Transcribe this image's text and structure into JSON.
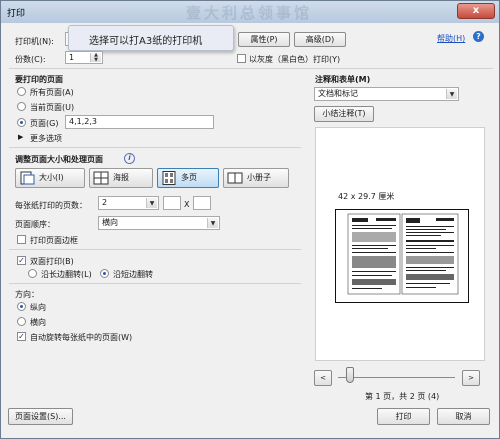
{
  "window": {
    "title": "打印",
    "close_glyph": "x"
  },
  "header": {
    "printer_label": "打印机(N):",
    "printer_value": "",
    "tooltip": "选择可以打A3纸的打印机",
    "properties_label": "属性(P)",
    "advanced_label": "高级(D)",
    "help_label": "帮助(H)",
    "copies_label": "份数(C):",
    "copies_value": "1",
    "grayscale_label": "以灰度（黑白色）打印(Y)"
  },
  "pages_section": {
    "title": "要打印的页面",
    "all_label": "所有页面(A)",
    "current_label": "当前页面(U)",
    "range_label": "页面(G)",
    "range_value": "4,1,2,3",
    "more_label": "更多选项",
    "selected": "range"
  },
  "comments_section": {
    "title": "注释和表单(M)",
    "dropdown_value": "文档和标记",
    "summarize_label": "小结注释(T)"
  },
  "sizing_section": {
    "title": "调整页面大小和处理页面",
    "info_glyph": "i",
    "size_label": "大小(I)",
    "poster_label": "海报",
    "multiple_label": "多页",
    "booklet_label": "小册子",
    "active": "multiple",
    "pages_per_sheet_label": "每张纸打印的页数：",
    "pages_per_sheet_value": "2",
    "times_label": "X",
    "page_order_label": "页面顺序：",
    "page_order_value": "横向",
    "print_border_label": "打印页面边框",
    "print_border_checked": false
  },
  "duplex_section": {
    "duplex_label": "双面打印(B)",
    "duplex_checked": true,
    "long_edge_label": "沿长边翻转(L)",
    "short_edge_label": "沿短边翻转",
    "selected": "short"
  },
  "orientation_section": {
    "title": "方向：",
    "portrait_label": "纵向",
    "landscape_label": "横向",
    "selected": "portrait",
    "auto_rotate_label": "自动旋转每张纸中的页面(W)",
    "auto_rotate_checked": true
  },
  "preview": {
    "size_text": "42 x 29.7 厘米",
    "page_status": "第 1 页，共 2 页 (4)",
    "prev_glyph": "<",
    "next_glyph": ">",
    "slider_position": 0
  },
  "footer": {
    "page_setup_label": "页面设置(S)...",
    "print_label": "打印",
    "cancel_label": "取消"
  },
  "watermark": "壹大利总领事馆",
  "colors": {
    "accent": "#2a5eaf",
    "link": "#1a4fc0",
    "close": "#c64a3c"
  }
}
